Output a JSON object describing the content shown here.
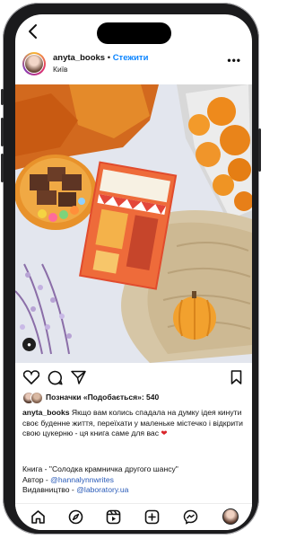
{
  "post": {
    "username": "anyta_books",
    "separator": "•",
    "follow_label": "Стежити",
    "location": "Київ",
    "more_label": "•••"
  },
  "likes": {
    "text": "Позначки «Подобається»: 540"
  },
  "caption": {
    "username": "anyta_books",
    "text": " Якщо вам колись спадала на думку ідея кинути своє буденне життя, переїхати у маленьке містечко і відкрити свою цукерню - ця книга саме для вас ",
    "heart": "❤"
  },
  "credits": {
    "book_line": "Книга - \"Солодка крамничка другого шансу\"",
    "author_prefix": "Автор - ",
    "author_handle": "@hannalynnwrites",
    "publisher_prefix": "Видавництво - ",
    "publisher_handle": "@laboratory.ua"
  },
  "icons": {
    "back": "back-arrow-icon",
    "like": "heart-icon",
    "comment": "comment-icon",
    "share": "share-icon",
    "save": "bookmark-icon",
    "home": "home-icon",
    "explore": "compass-icon",
    "reels": "reels-icon",
    "create": "plus-square-icon",
    "messages": "messenger-icon"
  },
  "colors": {
    "accent_link": "#0a84ff",
    "heart": "#d9252a"
  }
}
